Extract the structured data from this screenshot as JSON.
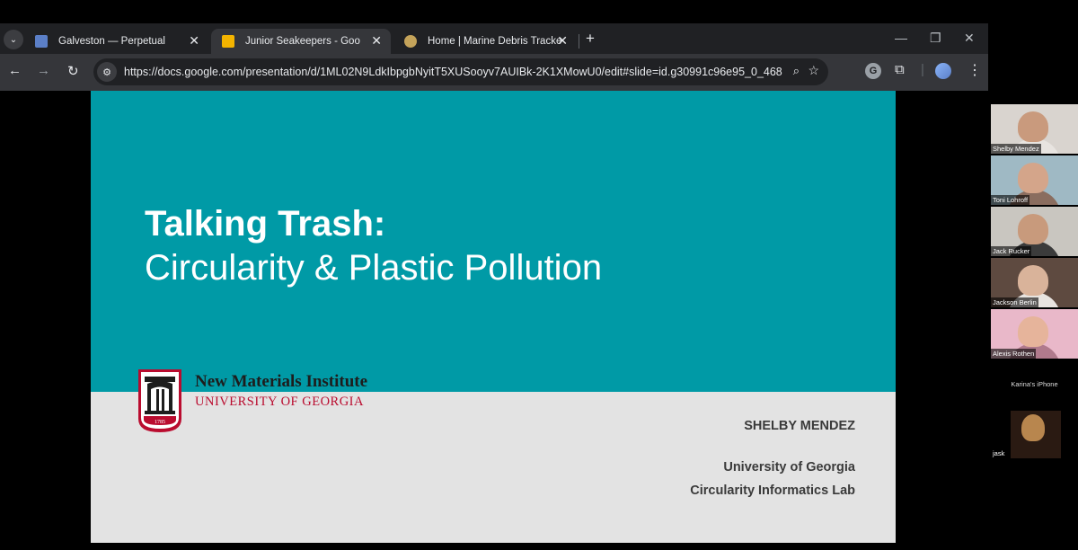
{
  "tabs": [
    {
      "title": "Galveston — Perpetual",
      "fav_color": "#5b7fc7",
      "active": false
    },
    {
      "title": "Junior Seakeepers - Google Slides",
      "fav_color": "#f4b400",
      "active": true
    },
    {
      "title": "Home | Marine Debris Tracker",
      "fav_color": "#c4a35a",
      "active": false
    }
  ],
  "omnibox": {
    "url": "https://docs.google.com/presentation/d/1ML02N9LdkIbpgbNyitT5XUSooyv7AUIBk-2K1XMowU0/edit#slide=id.g30991c96e95_0_468"
  },
  "slide": {
    "title_line1": "Talking Trash:",
    "title_line2": "Circularity & Plastic Pollution",
    "logo_institute": "New Materials Institute",
    "logo_university": "UNIVERSITY OF GEORGIA",
    "logo_year": "1785",
    "presenter": "SHELBY MENDEZ",
    "affiliation1": "University of Georgia",
    "affiliation2": "Circularity Informatics Lab",
    "colors": {
      "teal": "#009aa6",
      "gray": "#e3e3e3",
      "red": "#ba0c2f"
    }
  },
  "participants": [
    {
      "name": "Shelby Mendez"
    },
    {
      "name": "Toni Lohroff"
    },
    {
      "name": "Jack Rucker"
    },
    {
      "name": "Jackson Berlin"
    },
    {
      "name": "Alexis Rothen"
    },
    {
      "name": "Karina's iPhone"
    },
    {
      "name": "jask"
    }
  ]
}
